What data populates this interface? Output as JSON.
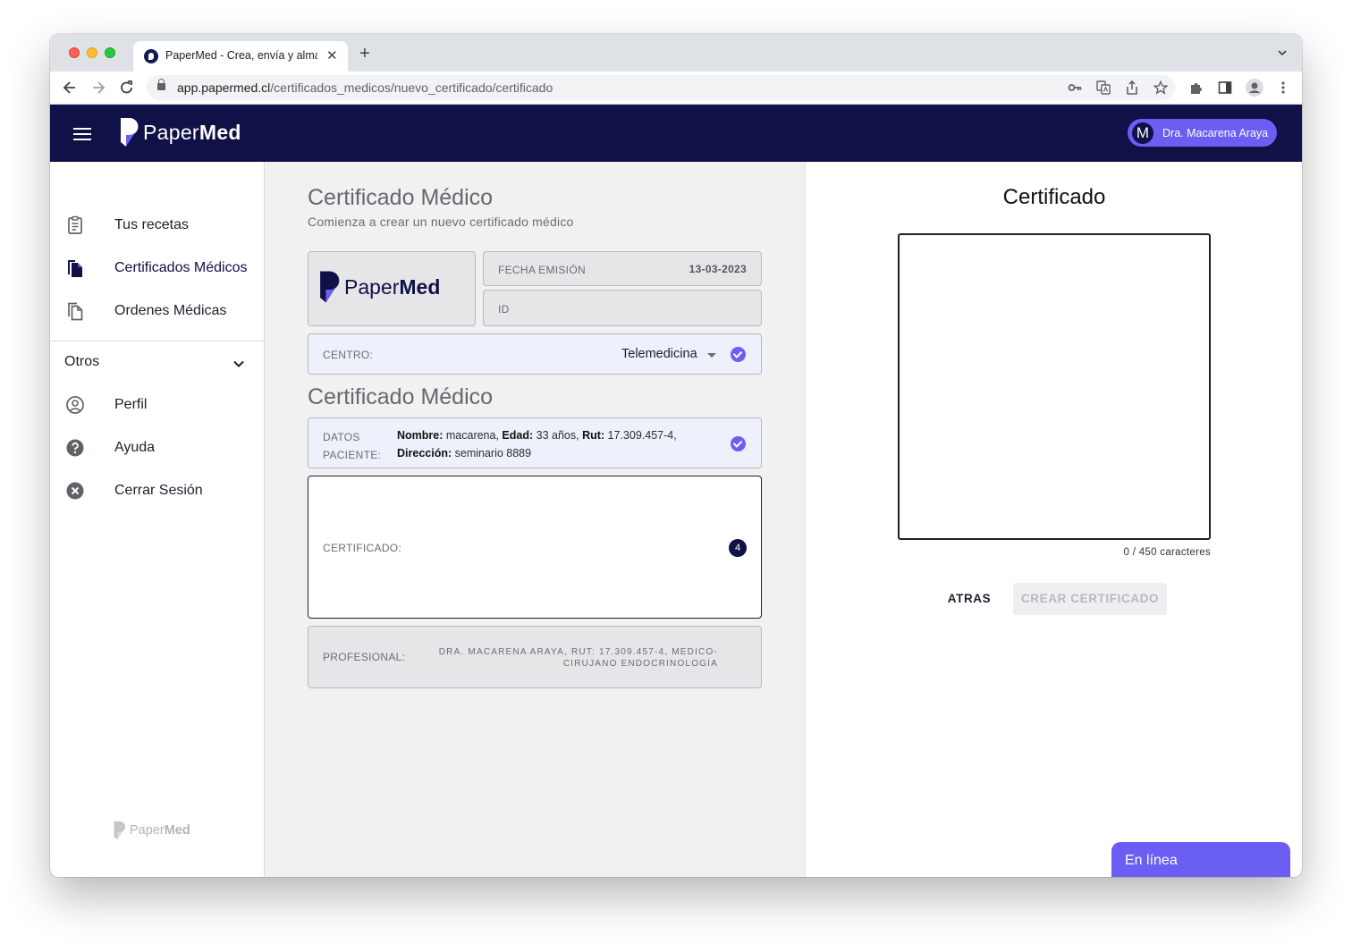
{
  "browser": {
    "tab_title": "PaperMed - Crea, envía y alma",
    "new_tab": "+",
    "close_tab": "✕",
    "url_domain": "app.papermed.cl",
    "url_path": "/certificados_medicos/nuevo_certificado/certificado"
  },
  "appbar": {
    "brand_light": "Paper",
    "brand_bold": "Med",
    "user_initial": "M",
    "user_name": "Dra. Macarena Araya"
  },
  "sidebar": {
    "items": [
      {
        "label": "Tus recetas",
        "icon": "clipboard-icon"
      },
      {
        "label": "Certificados Médicos",
        "icon": "documents-filled-icon"
      },
      {
        "label": "Ordenes Médicas",
        "icon": "documents-outline-icon"
      }
    ],
    "section_label": "Otros",
    "section_items": [
      {
        "label": "Perfil",
        "icon": "account-circle-icon"
      },
      {
        "label": "Ayuda",
        "icon": "help-icon"
      },
      {
        "label": "Cerrar Sesión",
        "icon": "cancel-icon"
      }
    ]
  },
  "form": {
    "title": "Certificado Médico",
    "subtitle": "Comienza a crear un nuevo certificado médico",
    "fecha_label": "FECHA EMISIÓN",
    "fecha_value": "13-03-2023",
    "id_label": "ID",
    "centro_label": "CENTRO:",
    "centro_value": "Telemedicina",
    "section_title": "Certificado Médico",
    "datos_label": "DATOS PACIENTE:",
    "datos_nombre_key": "Nombre:",
    "datos_nombre_val": " macarena, ",
    "datos_edad_key": "Edad:",
    "datos_edad_val": " 33 años, ",
    "datos_rut_key": "Rut:",
    "datos_rut_val": " 17.309.457-4,",
    "datos_dir_key": "Dirección:",
    "datos_dir_val": " seminario 8889",
    "certificado_label": "CERTIFICADO:",
    "certificado_step": "4",
    "profesional_label": "PROFESIONAL:",
    "profesional_value": "DRA. MACARENA ARAYA, RUT: 17.309.457-4, MEDICO-CIRUJANO ENDOCRINOLOGÍA"
  },
  "preview": {
    "title": "Certificado",
    "char_count": "0 / 450 caracteres",
    "back_label": "ATRAS",
    "create_label": "CREAR CERTIFICADO"
  },
  "chat": {
    "status": "En línea"
  },
  "colors": {
    "navy": "#0f1147",
    "accent": "#6b5ef2"
  }
}
